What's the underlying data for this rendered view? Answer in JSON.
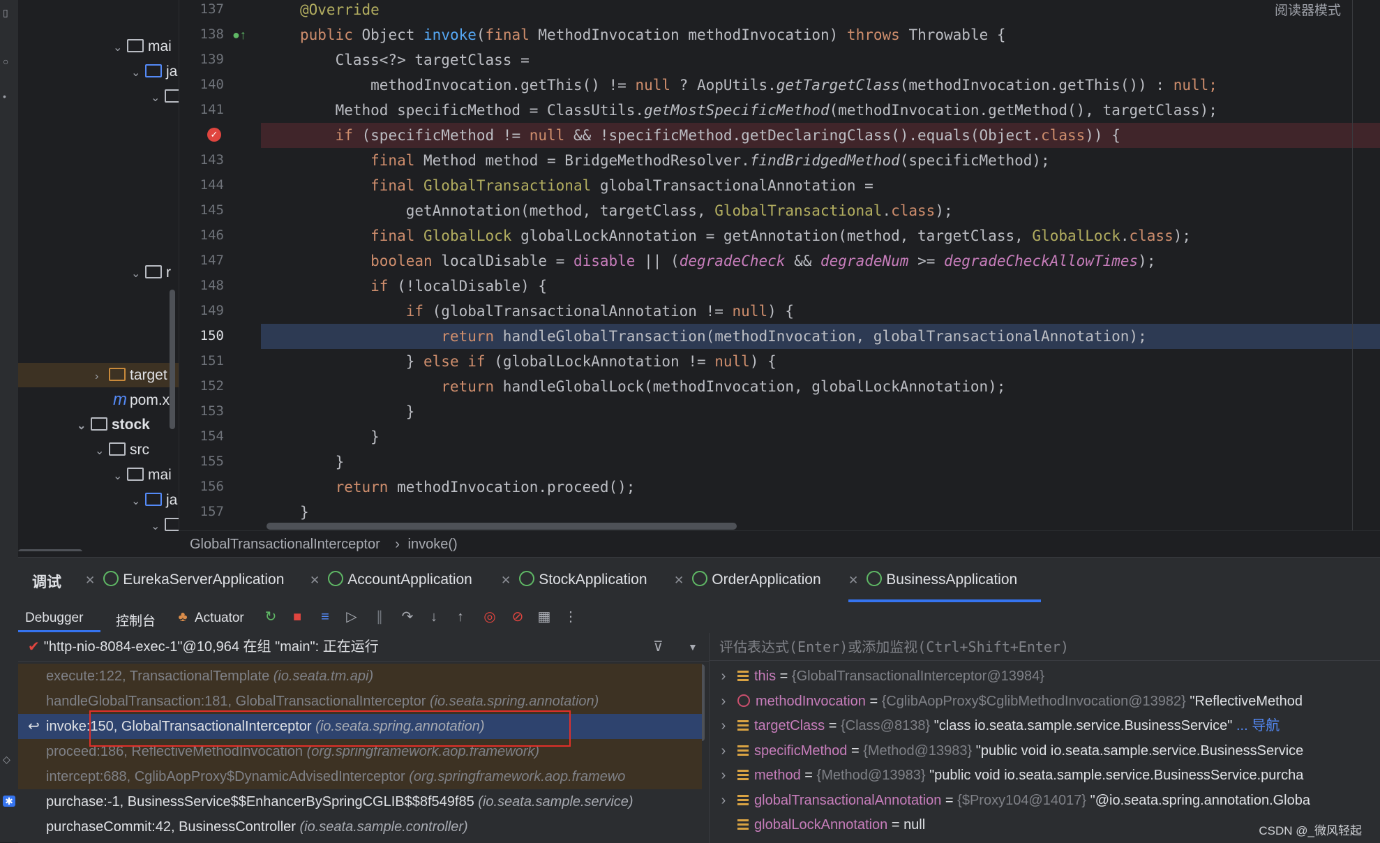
{
  "editor": {
    "reader_mode": "阅读器模式",
    "lines": [
      {
        "no": "137",
        "tokens": [
          [
            "an",
            "@Override"
          ]
        ]
      },
      {
        "no": "138",
        "tokens": [
          [
            "kw",
            "public "
          ],
          [
            "ty",
            "Object "
          ],
          [
            "fn",
            "invoke"
          ],
          [
            "ty",
            "("
          ],
          [
            "kw",
            "final "
          ],
          [
            "ty",
            "MethodInvocation methodInvocation) "
          ],
          [
            "kw",
            "throws "
          ],
          [
            "ty",
            "Throwable {"
          ]
        ]
      },
      {
        "no": "139",
        "tokens": [
          [
            "ty",
            "    Class<?> targetClass ="
          ]
        ]
      },
      {
        "no": "140",
        "tokens": [
          [
            "ty",
            "        methodInvocation.getThis() != "
          ],
          [
            "kw",
            "null "
          ],
          [
            "ty",
            "? AopUtils."
          ],
          [
            "it",
            "getTargetClass"
          ],
          [
            "ty",
            "(methodInvocation.getThis()) : "
          ],
          [
            "kw",
            "null;"
          ]
        ]
      },
      {
        "no": "141",
        "tokens": [
          [
            "ty",
            "    Method specificMethod = ClassUtils."
          ],
          [
            "it",
            "getMostSpecificMethod"
          ],
          [
            "ty",
            "(methodInvocation.getMethod(), targetClass);"
          ]
        ]
      },
      {
        "no": "",
        "tokens": [
          [
            "kw",
            "    if "
          ],
          [
            "ty",
            "(specificMethod != "
          ],
          [
            "kw",
            "null "
          ],
          [
            "ty",
            "&& !specificMethod.getDeclaringClass().equals(Object."
          ],
          [
            "kw",
            "class"
          ],
          [
            "ty",
            ")) {"
          ]
        ]
      },
      {
        "no": "143",
        "tokens": [
          [
            "kw",
            "        final "
          ],
          [
            "ty",
            "Method method = BridgeMethodResolver."
          ],
          [
            "it",
            "findBridgedMethod"
          ],
          [
            "ty",
            "(specificMethod);"
          ]
        ]
      },
      {
        "no": "144",
        "tokens": [
          [
            "kw",
            "        final "
          ],
          [
            "an",
            "GlobalTransactional "
          ],
          [
            "ty",
            "globalTransactionalAnnotation ="
          ]
        ]
      },
      {
        "no": "145",
        "tokens": [
          [
            "ty",
            "            getAnnotation(method, targetClass, "
          ],
          [
            "an",
            "GlobalTransactional"
          ],
          [
            "ty",
            "."
          ],
          [
            "kw",
            "class"
          ],
          [
            "ty",
            ");"
          ]
        ]
      },
      {
        "no": "146",
        "tokens": [
          [
            "kw",
            "        final "
          ],
          [
            "an",
            "GlobalLock "
          ],
          [
            "ty",
            "globalLockAnnotation = getAnnotation(method, targetClass, "
          ],
          [
            "an",
            "GlobalLock"
          ],
          [
            "ty",
            "."
          ],
          [
            "kw",
            "class"
          ],
          [
            "ty",
            ");"
          ]
        ]
      },
      {
        "no": "147",
        "tokens": [
          [
            "kw",
            "        boolean "
          ],
          [
            "ty",
            "localDisable = "
          ],
          [
            "fld",
            "disable "
          ],
          [
            "ty",
            "|| ("
          ],
          [
            "fldi",
            "degradeCheck "
          ],
          [
            "ty",
            "&& "
          ],
          [
            "fldi",
            "degradeNum "
          ],
          [
            "ty",
            ">= "
          ],
          [
            "fldi",
            "degradeCheckAllowTimes"
          ],
          [
            "ty",
            ");"
          ]
        ]
      },
      {
        "no": "148",
        "tokens": [
          [
            "kw",
            "        if "
          ],
          [
            "ty",
            "(!localDisable) {"
          ]
        ]
      },
      {
        "no": "149",
        "tokens": [
          [
            "kw",
            "            if "
          ],
          [
            "ty",
            "(globalTransactionalAnnotation != "
          ],
          [
            "kw",
            "null"
          ],
          [
            "ty",
            ") {"
          ]
        ]
      },
      {
        "no": "150",
        "tokens": [
          [
            "kw",
            "                return "
          ],
          [
            "ty",
            "handleGlobalTransaction(methodInvocation, globalTransactionalAnnotation);"
          ]
        ]
      },
      {
        "no": "151",
        "tokens": [
          [
            "ty",
            "            } "
          ],
          [
            "kw",
            "else if "
          ],
          [
            "ty",
            "(globalLockAnnotation != "
          ],
          [
            "kw",
            "null"
          ],
          [
            "ty",
            ") {"
          ]
        ]
      },
      {
        "no": "152",
        "tokens": [
          [
            "kw",
            "                return "
          ],
          [
            "ty",
            "handleGlobalLock(methodInvocation, globalLockAnnotation);"
          ]
        ]
      },
      {
        "no": "153",
        "tokens": [
          [
            "ty",
            "            }"
          ]
        ]
      },
      {
        "no": "154",
        "tokens": [
          [
            "ty",
            "        }"
          ]
        ]
      },
      {
        "no": "155",
        "tokens": [
          [
            "ty",
            "    }"
          ]
        ]
      },
      {
        "no": "156",
        "tokens": [
          [
            "kw",
            "    return "
          ],
          [
            "ty",
            "methodInvocation.proceed();"
          ]
        ]
      },
      {
        "no": "157",
        "tokens": [
          [
            "ty",
            "}"
          ]
        ]
      }
    ]
  },
  "tree": {
    "items": [
      {
        "label": "mai"
      },
      {
        "label": "ja"
      },
      {
        "label": "r"
      },
      {
        "label": "target"
      },
      {
        "label": "pom.xı"
      },
      {
        "label": "stock"
      },
      {
        "label": "src"
      },
      {
        "label": "mai"
      },
      {
        "label": "ja"
      }
    ]
  },
  "breadcrumb": {
    "class_name": "GlobalTransactionalInterceptor",
    "method_name": "invoke()"
  },
  "debug": {
    "title": "调试",
    "tabs": [
      "EurekaServerApplication",
      "AccountApplication",
      "StockApplication",
      "OrderApplication",
      "BusinessApplication"
    ],
    "toolbar": {
      "debugger": "Debugger",
      "console": "控制台",
      "actuator": "Actuator"
    },
    "thread": "\"http-nio-8084-exec-1\"@10,964 在组 \"main\": 正在运行",
    "eval_placeholder": "评估表达式(Enter)或添加监视(Ctrl+Shift+Enter)",
    "frames": [
      {
        "text": "execute:122, TransactionalTemplate ",
        "pkg": "(io.seata.tm.api)",
        "kind": "lib"
      },
      {
        "text": "handleGlobalTransaction:181, GlobalTransactionalInterceptor ",
        "pkg": "(io.seata.spring.annotation)",
        "kind": "lib"
      },
      {
        "text": "invoke:150, GlobalTransactionalInterceptor ",
        "pkg": "(io.seata.spring.annotation)",
        "kind": "sel"
      },
      {
        "text": "proceed:186, ReflectiveMethodInvocation ",
        "pkg": "(org.springframework.aop.framework)",
        "kind": "lib"
      },
      {
        "text": "intercept:688, CglibAopProxy$DynamicAdvisedInterceptor ",
        "pkg": "(org.springframework.aop.framewo",
        "kind": "lib"
      },
      {
        "text": "purchase:-1, BusinessService$$EnhancerBySpringCGLIB$$8f549f85 ",
        "pkg": "(io.seata.sample.service)",
        "kind": "usr"
      },
      {
        "text": "purchaseCommit:42, BusinessController ",
        "pkg": "(io.seata.sample.controller)",
        "kind": "usr"
      }
    ],
    "variables": [
      {
        "name": "this",
        "ref": "{GlobalTransactionalInterceptor@13984}",
        "value": "",
        "nav": "",
        "icon": "field",
        "expandable": true
      },
      {
        "name": "methodInvocation",
        "ref": "{CglibAopProxy$CglibMethodInvocation@13982}",
        "value": "\"ReflectiveMethod",
        "nav": "",
        "icon": "param",
        "expandable": true
      },
      {
        "name": "targetClass",
        "ref": "{Class@8138}",
        "value": "\"class io.seata.sample.service.BusinessService\"",
        "nav": "... 导航",
        "icon": "field",
        "expandable": true
      },
      {
        "name": "specificMethod",
        "ref": "{Method@13983}",
        "value": "\"public void io.seata.sample.service.BusinessService",
        "nav": "",
        "icon": "field",
        "expandable": true
      },
      {
        "name": "method",
        "ref": "{Method@13983}",
        "value": "\"public void io.seata.sample.service.BusinessService.purcha",
        "nav": "",
        "icon": "field",
        "expandable": true
      },
      {
        "name": "globalTransactionalAnnotation",
        "ref": "{$Proxy104@14017}",
        "value": "\"@io.seata.spring.annotation.Globa",
        "nav": "",
        "icon": "field",
        "expandable": true
      },
      {
        "name": "globalLockAnnotation",
        "ref": "",
        "value": "null",
        "nav": "",
        "icon": "field",
        "expandable": false
      }
    ]
  },
  "watermark": "CSDN @_微风轻起",
  "colors": {
    "accent": "#3574f0",
    "highlight_box": "#e0302a",
    "breakpoint_line": "#40252a",
    "exec_line": "#2d3a53"
  }
}
